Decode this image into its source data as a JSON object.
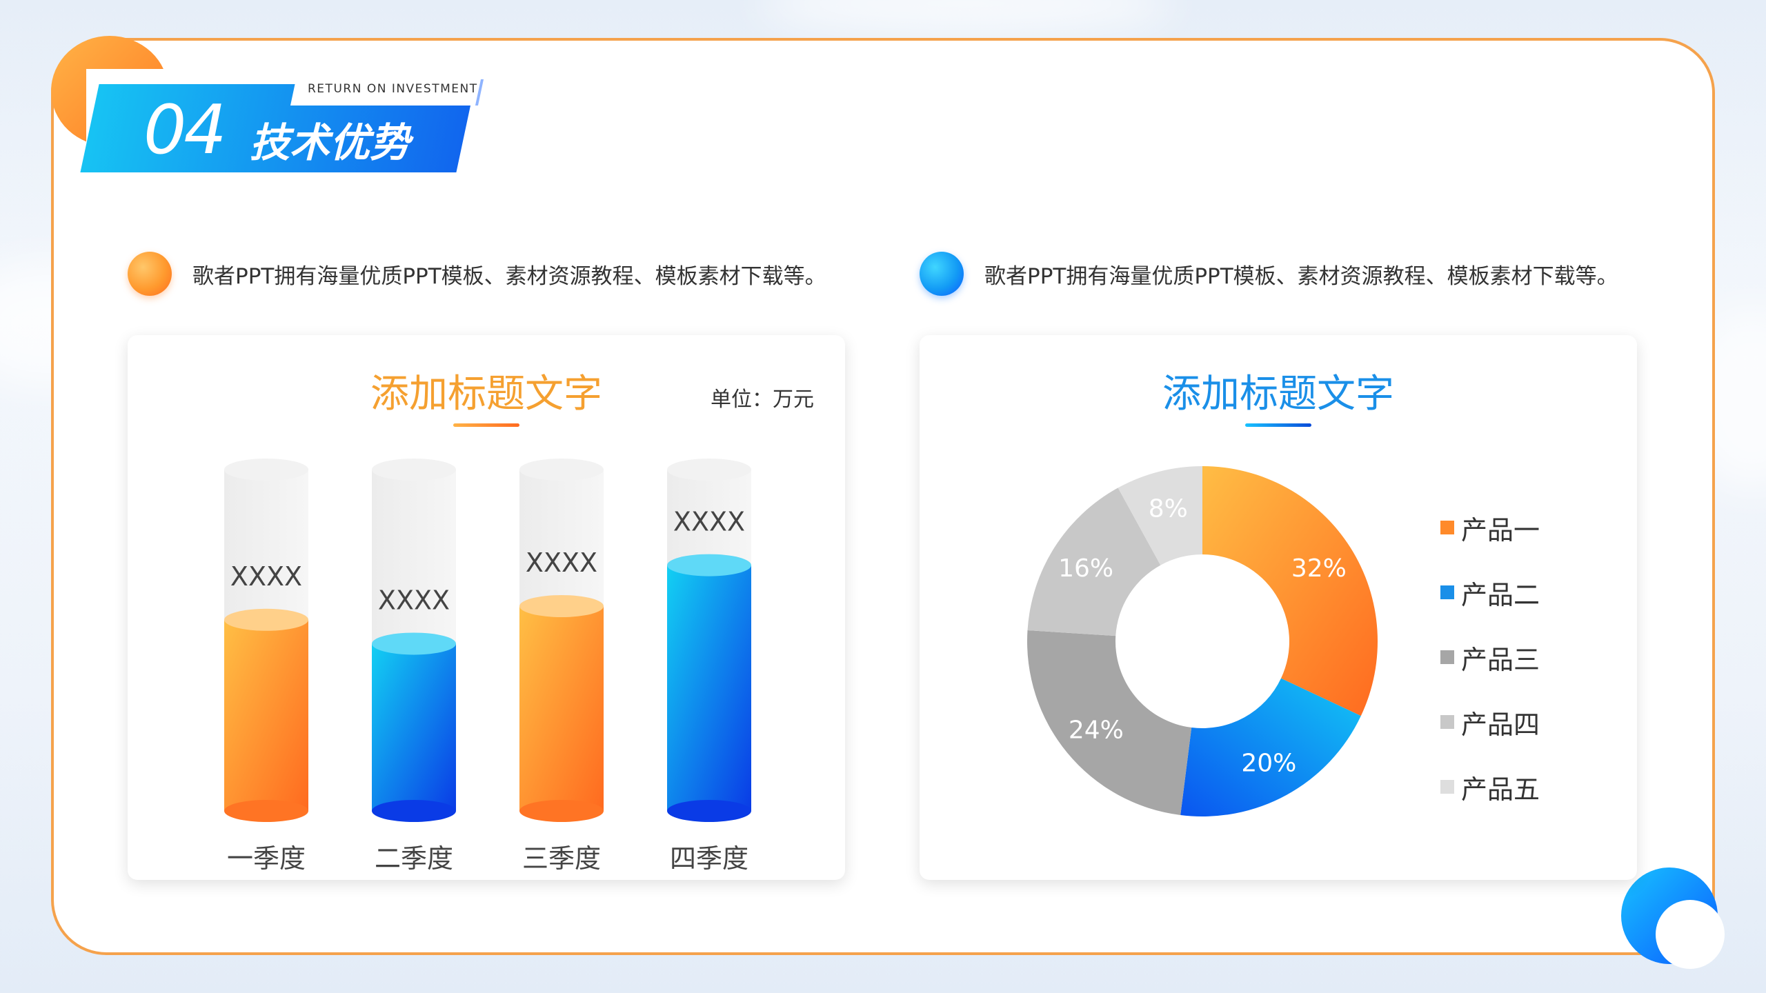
{
  "header": {
    "number": "04",
    "title": "技术优势",
    "subtitle": "RETURN ON INVESTMENT"
  },
  "bullets": [
    {
      "text": "歌者PPT拥有海量优质PPT模板、素材资源教程、模板素材下载等。",
      "color": "#ff8a2a"
    },
    {
      "text": "歌者PPT拥有海量优质PPT模板、素材资源教程、模板素材下载等。",
      "color": "#1a8fe8"
    }
  ],
  "cards": {
    "bar_title": "添加标题文字",
    "bar_unit": "单位：万元",
    "pie_title": "添加标题文字"
  },
  "chart_data": [
    {
      "type": "bar",
      "title": "添加标题文字",
      "unit": "单位：万元",
      "categories": [
        "一季度",
        "二季度",
        "三季度",
        "四季度"
      ],
      "values": [
        0.56,
        0.49,
        0.6,
        0.72
      ],
      "value_labels": [
        "XXXX",
        "XXXX",
        "XXXX",
        "XXXX"
      ],
      "colors": [
        "orange",
        "blue",
        "orange",
        "blue"
      ],
      "ylim": [
        0,
        1
      ]
    },
    {
      "type": "pie",
      "title": "添加标题文字",
      "donut": true,
      "labels": [
        "产品一",
        "产品二",
        "产品三",
        "产品四",
        "产品五"
      ],
      "values": [
        32,
        20,
        24,
        16,
        8
      ],
      "value_labels": [
        "32%",
        "20%",
        "24%",
        "16%",
        "8%"
      ],
      "colors": [
        "#ff8a2a",
        "#1a8fe8",
        "#a6a6a6",
        "#c8c8c8",
        "#dedede"
      ],
      "legend": "right"
    }
  ]
}
